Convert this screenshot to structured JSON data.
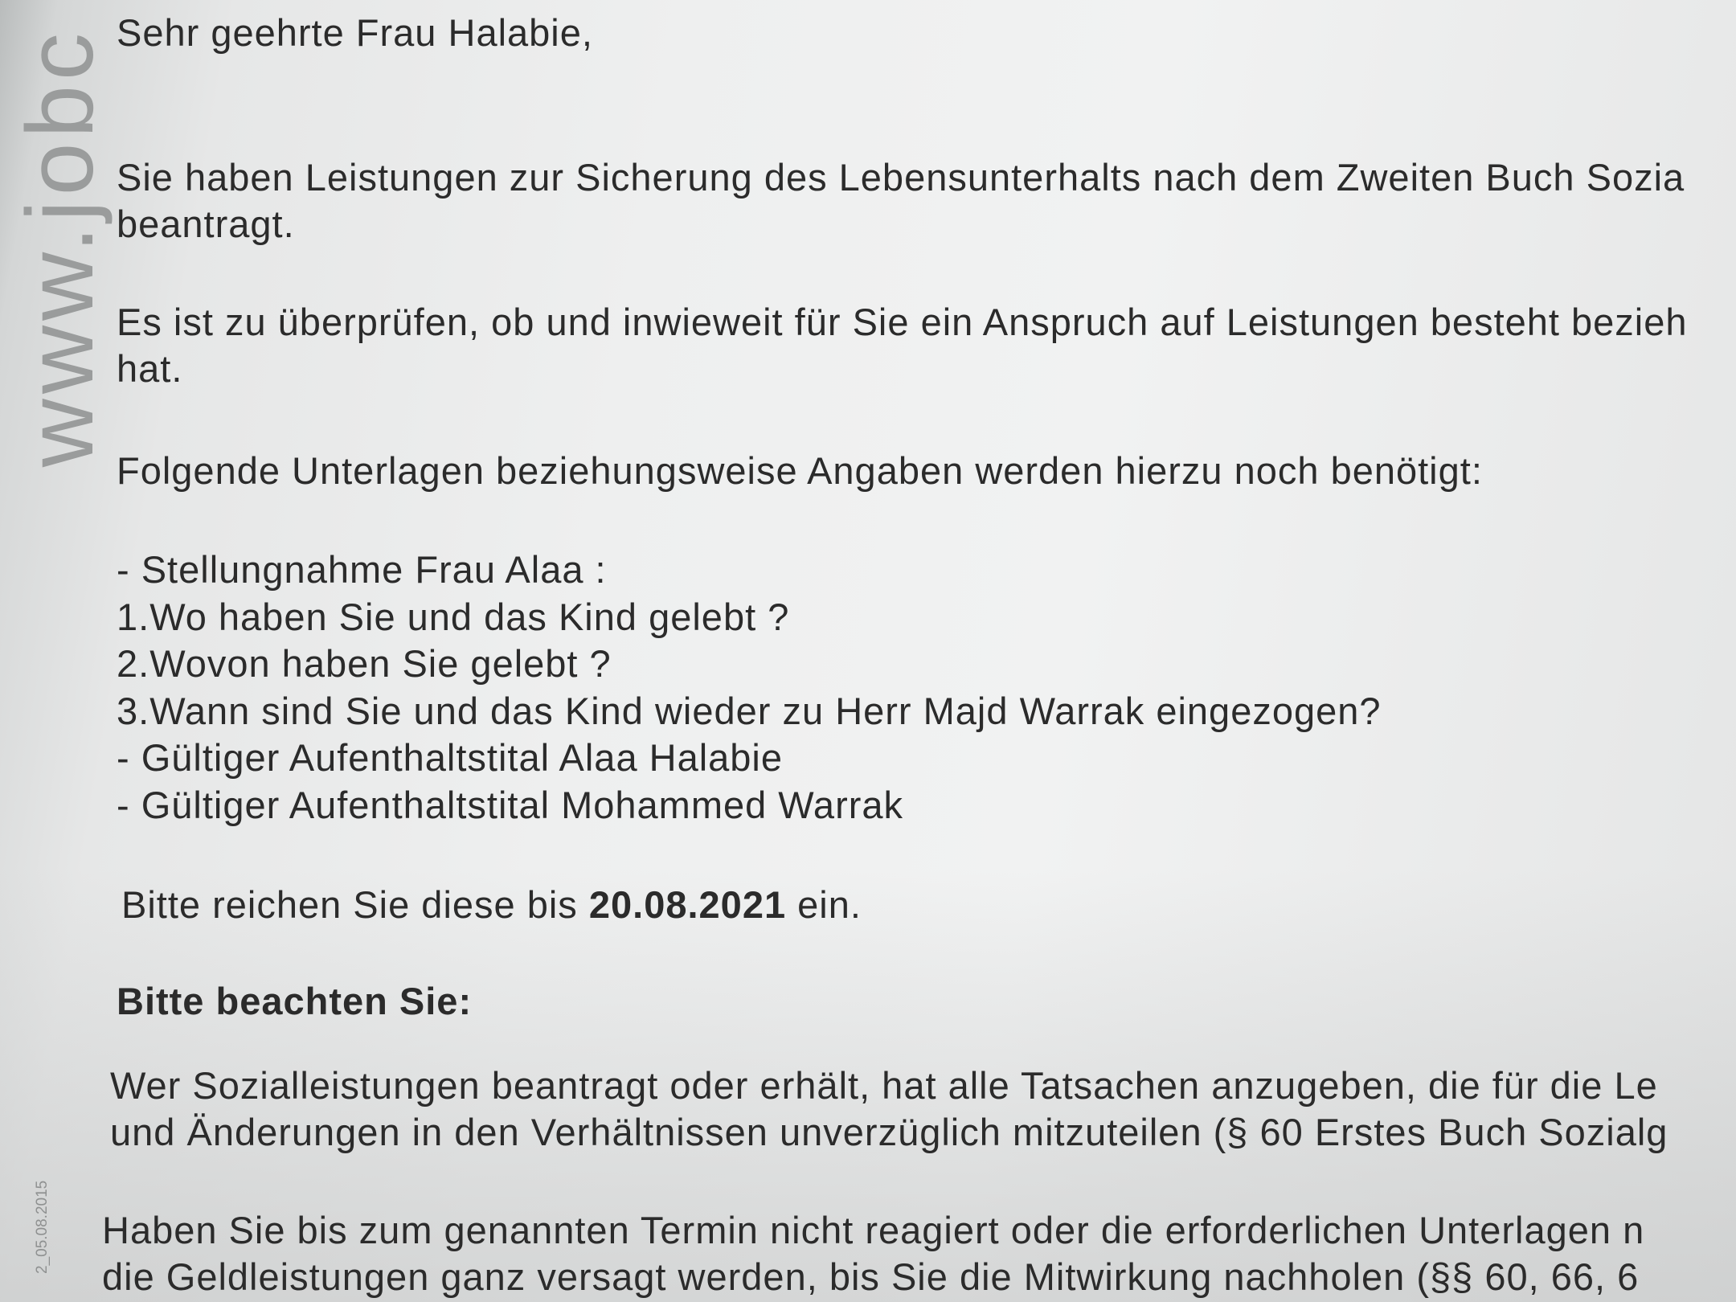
{
  "watermark": "www.jobc",
  "footer_stamp": "2_05.08.2015",
  "letter": {
    "salutation": "Sehr geehrte Frau Halabie,",
    "paragraph1": [
      "Sie haben Leistungen zur Sicherung des Lebensunterhalts nach dem Zweiten Buch Sozia",
      "beantragt."
    ],
    "paragraph2": [
      "Es ist zu überprüfen, ob und inwieweit für Sie ein Anspruch auf Leistungen besteht bezieh",
      "hat."
    ],
    "paragraph3": "Folgende Unterlagen beziehungsweise Angaben werden hierzu noch benötigt:",
    "requirements": [
      "- Stellungnahme Frau Alaa :",
      "1.Wo haben Sie und das Kind gelebt ?",
      "2.Wovon haben Sie gelebt ?",
      "3.Wann sind Sie und das Kind wieder zu Herr Majd Warrak eingezogen?",
      "- Gültiger Aufenthaltstital Alaa Halabie",
      "- Gültiger Aufenthaltstital Mohammed Warrak"
    ],
    "deadline_prefix": "Bitte reichen Sie diese bis",
    "deadline_date": "20.08.2021",
    "deadline_suffix": "ein.",
    "notice_heading": "Bitte beachten Sie:",
    "paragraph4": [
      "Wer Sozialleistungen beantragt oder erhält, hat alle Tatsachen anzugeben, die für die Le",
      "und Änderungen in den Verhältnissen unverzüglich mitzuteilen (§ 60 Erstes Buch Sozialg"
    ],
    "paragraph5": [
      "Haben Sie bis zum genannten Termin nicht reagiert oder die erforderlichen Unterlagen n",
      "die Geldleistungen ganz versagt werden, bis Sie die Mitwirkung nachholen (§§ 60, 66, 6"
    ]
  }
}
